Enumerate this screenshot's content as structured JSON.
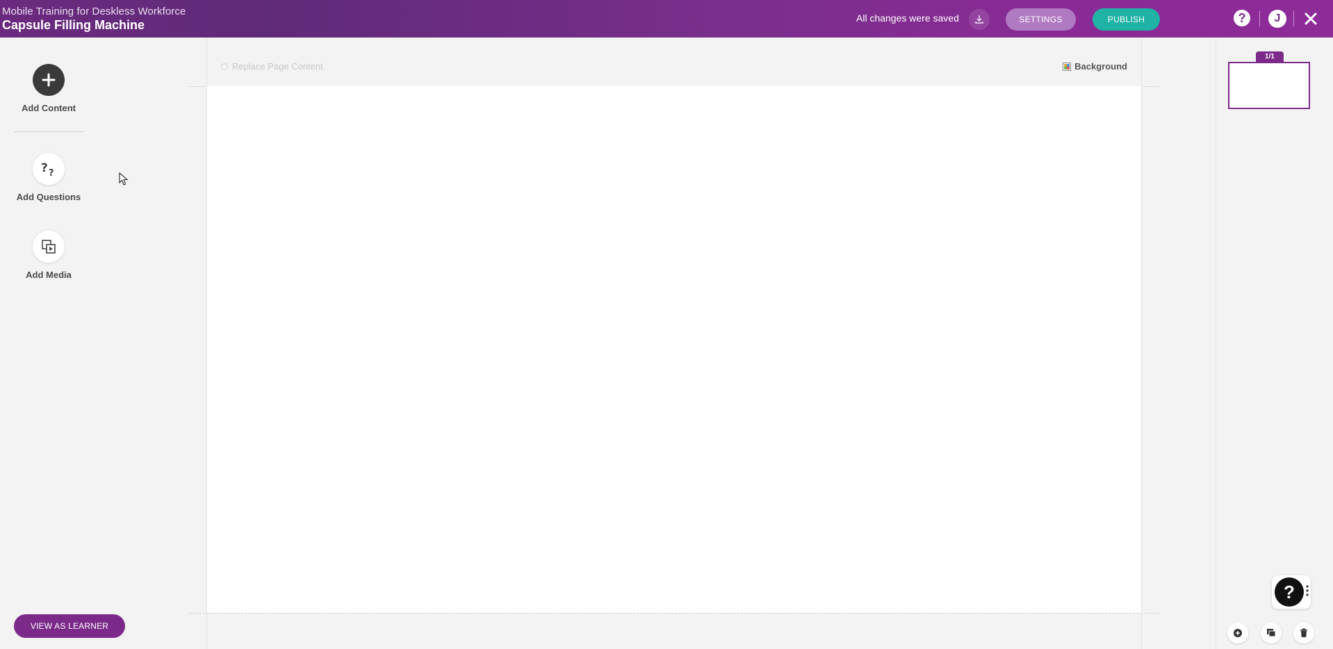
{
  "header": {
    "course_title": "Mobile Training for Deskless Workforce",
    "lesson_title": "Capsule Filling Machine",
    "save_status": "All changes were saved",
    "settings_label": "SETTINGS",
    "publish_label": "PUBLISH",
    "help_glyph": "?",
    "avatar_initial": "J",
    "icons": {
      "export": "export-icon",
      "help": "help-icon",
      "avatar": "user-avatar",
      "close": "close-icon"
    }
  },
  "sidebar": {
    "tools": [
      {
        "label": "Add Content",
        "icon": "plus-icon"
      },
      {
        "label": "Add Questions",
        "icon": "question-icon"
      },
      {
        "label": "Add Media",
        "icon": "media-icon"
      }
    ],
    "view_as_learner_label": "VIEW AS LEARNER"
  },
  "canvas": {
    "replace_label": "Replace Page Content",
    "background_label": "Background"
  },
  "pages_panel": {
    "page_indicator": "1/1",
    "actions": [
      "add-page-icon",
      "duplicate-page-icon",
      "delete-page-icon"
    ]
  },
  "support": {
    "glyph": "?"
  },
  "colors": {
    "brand_purple": "#7b2a8a",
    "settings_pill": "#b07ac2",
    "publish_teal": "#1fb3a5"
  }
}
